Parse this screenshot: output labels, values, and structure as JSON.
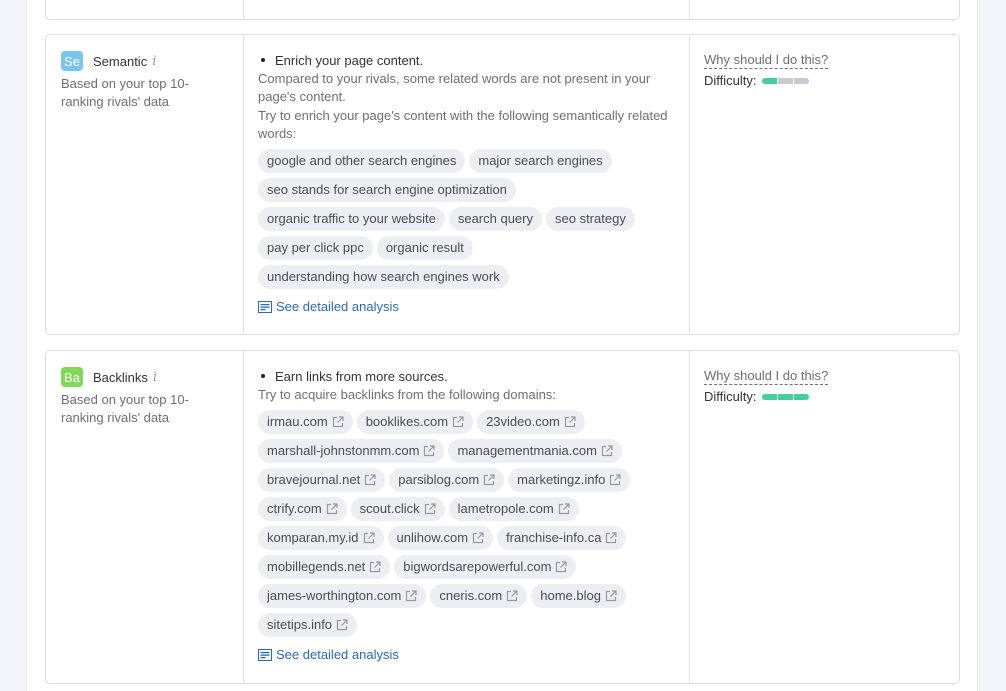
{
  "colors": {
    "semantic_badge": "#79c4f2",
    "backlinks_badge": "#7ed957",
    "link": "#2b6cb0",
    "difficulty_on": "#45cda0",
    "difficulty_off": "#c8cad0"
  },
  "cards": [
    {
      "id": "semantic",
      "badge": "Se",
      "title": "Semantic",
      "info_icon": "info-icon",
      "subtitle": "Based on your top 10-ranking rivals' data",
      "bullet": "Enrich your page content.",
      "description": [
        "Compared to your rivals, some related words are not present in your page's content.",
        "Try to enrich your page's content with the following semantically related words:"
      ],
      "chips": [
        "google and other search engines",
        "major search engines",
        "seo stands for search engine optimization",
        "organic traffic to your website",
        "search query",
        "seo strategy",
        "pay per click ppc",
        "organic result",
        "understanding how search engines work"
      ],
      "chips_external": false,
      "detail_link": "See detailed analysis",
      "why_link": "Why should I do this?",
      "difficulty_label": "Difficulty:",
      "difficulty_level": 1,
      "difficulty_max": 3
    },
    {
      "id": "backlinks",
      "badge": "Ba",
      "title": "Backlinks",
      "info_icon": "info-icon",
      "subtitle": "Based on your top 10-ranking rivals' data",
      "bullet": "Earn links from more sources.",
      "description": [
        "Try to acquire backlinks from the following domains:"
      ],
      "chips": [
        "irmau.com",
        "booklikes.com",
        "23video.com",
        "marshall-johnstonmm.com",
        "managementmania.com",
        "bravejournal.net",
        "parsiblog.com",
        "marketingz.info",
        "ctrify.com",
        "scout.click",
        "lametropole.com",
        "komparan.my.id",
        "unlihow.com",
        "franchise-info.ca",
        "mobillegends.net",
        "bigwordsarepowerful.com",
        "james-worthington.com",
        "cneris.com",
        "home.blog",
        "sitetips.info"
      ],
      "chips_external": true,
      "detail_link": "See detailed analysis",
      "why_link": "Why should I do this?",
      "difficulty_label": "Difficulty:",
      "difficulty_level": 3,
      "difficulty_max": 3
    }
  ]
}
